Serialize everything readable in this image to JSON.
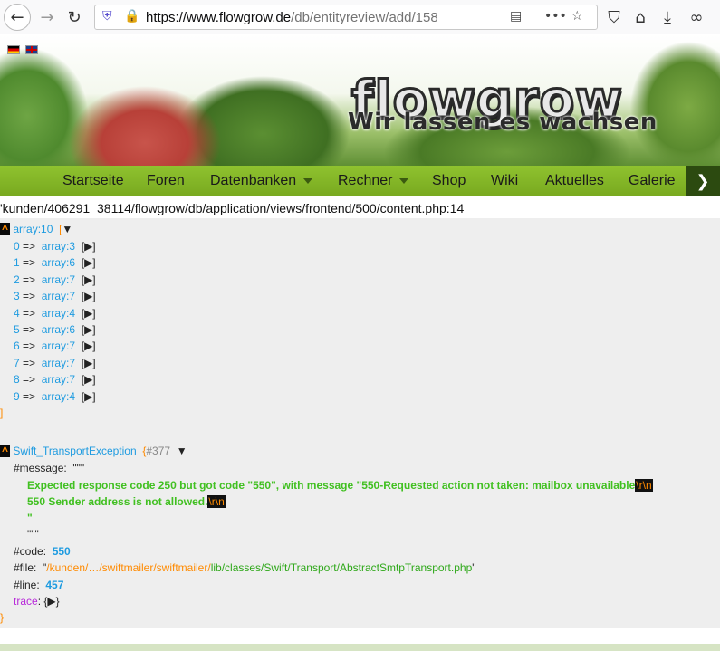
{
  "browser": {
    "url_host": "https://www.flowgrow.de",
    "url_path": "/db/entityreview/add/158"
  },
  "header": {
    "logo_text": "flowgrow",
    "slogan": "Wir lassen es wachsen"
  },
  "nav": {
    "items": [
      {
        "label": "Startseite",
        "dropdown": false
      },
      {
        "label": "Foren",
        "dropdown": false
      },
      {
        "label": "Datenbanken",
        "dropdown": true
      },
      {
        "label": "Rechner",
        "dropdown": true
      },
      {
        "label": "Shop",
        "dropdown": false
      },
      {
        "label": "Wiki",
        "dropdown": false
      },
      {
        "label": "Aktuelles",
        "dropdown": false
      },
      {
        "label": "Galerie",
        "dropdown": false
      }
    ]
  },
  "content": {
    "path": "'kunden/406291_38114/flowgrow/db/application/views/frontend/500/content.php:14",
    "array_head": "array:10",
    "array_items": [
      {
        "key": "0",
        "type": "array:3"
      },
      {
        "key": "1",
        "type": "array:6"
      },
      {
        "key": "2",
        "type": "array:7"
      },
      {
        "key": "3",
        "type": "array:7"
      },
      {
        "key": "4",
        "type": "array:4"
      },
      {
        "key": "5",
        "type": "array:6"
      },
      {
        "key": "6",
        "type": "array:7"
      },
      {
        "key": "7",
        "type": "array:7"
      },
      {
        "key": "8",
        "type": "array:7"
      },
      {
        "key": "9",
        "type": "array:4"
      }
    ],
    "exception": {
      "class": "Swift_TransportException",
      "id": "#377",
      "message_label": "#message:",
      "message_line1": "Expected response code 250 but got code \"550\", with message \"550-Requested action not taken: mailbox unavailable",
      "message_line2": "550 Sender address is not allowed.",
      "code_label": "#code:",
      "code_value": "550",
      "file_label": "#file:",
      "file_prefix": "/kunden/…/swiftmailer/swiftmailer/",
      "file_rest": "lib/classes/Swift/Transport/AbstractSmtpTransport.php",
      "line_label": "#line:",
      "line_value": "457",
      "trace_label": "trace"
    }
  }
}
